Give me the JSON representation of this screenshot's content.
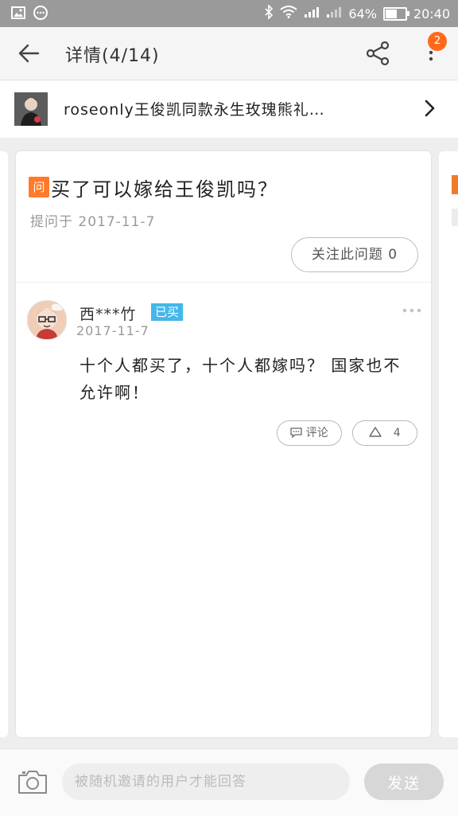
{
  "status_bar": {
    "battery": "64%",
    "battery_level": 0.64,
    "time": "20:40"
  },
  "header": {
    "title": "详情(4/14)",
    "notification_count": "2"
  },
  "product": {
    "name": "roseonly王俊凯同款永生玫瑰熊礼…"
  },
  "question": {
    "badge": "问",
    "text": "买了可以嫁给王俊凯吗？",
    "date": "提问于 2017-11-7",
    "follow_label": "关注此问题 0"
  },
  "answer": {
    "username": "西***竹",
    "bought_badge": "已买",
    "date": "2017-11-7",
    "text": "十个人都买了，十个人都嫁吗？ 国家也不允许啊！",
    "comment_label": "评论",
    "like_count": "4"
  },
  "bottom": {
    "input_placeholder": "被随机邀请的用户才能回答",
    "send_label": "发送"
  },
  "colors": {
    "accent_orange": "#ff7a2a",
    "bought_blue": "#44b7ea",
    "statusbar_gray": "#9a9a9a"
  }
}
